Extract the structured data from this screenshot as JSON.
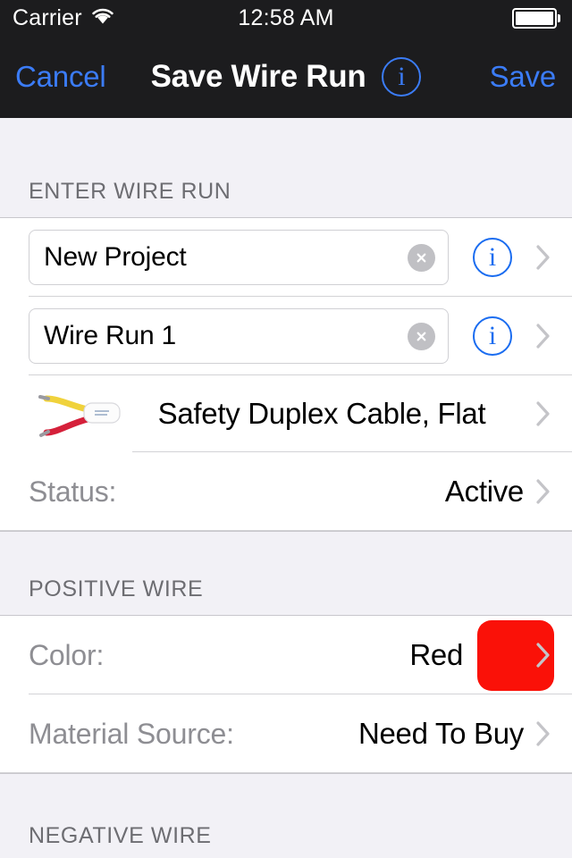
{
  "status_bar": {
    "carrier": "Carrier",
    "wifi_icon": "wifi-icon",
    "time": "12:58 AM",
    "battery_icon": "battery-full-icon"
  },
  "nav_bar": {
    "cancel_label": "Cancel",
    "title": "Save Wire Run",
    "info_icon": "info-circle-icon",
    "info_glyph": "i",
    "save_label": "Save"
  },
  "sections": [
    {
      "header": "ENTER WIRE RUN",
      "rows": [
        {
          "kind": "textfield",
          "name": "project-name",
          "value": "New Project",
          "placeholder": "Project Name",
          "clear_icon": "clear-circle-icon",
          "info_icon": "info-circle-icon",
          "info_glyph": "i",
          "chevron_icon": "chevron-right-icon"
        },
        {
          "kind": "textfield",
          "name": "wire-run-name",
          "value": "Wire Run 1",
          "placeholder": "Wire Run Name",
          "clear_icon": "clear-circle-icon",
          "info_icon": "info-circle-icon",
          "info_glyph": "i",
          "chevron_icon": "chevron-right-icon"
        },
        {
          "kind": "cable",
          "name": "cable-type",
          "image_icon": "duplex-cable-image",
          "value": "Safety Duplex Cable, Flat",
          "chevron_icon": "chevron-right-icon"
        },
        {
          "kind": "labelvalue",
          "name": "status",
          "label": "Status:",
          "value": "Active",
          "chevron_icon": "chevron-right-icon"
        }
      ]
    },
    {
      "header": "POSITIVE WIRE",
      "rows": [
        {
          "kind": "color",
          "name": "positive-wire-color",
          "label": "Color:",
          "value": "Red",
          "swatch_color": "#fa1108",
          "chevron_icon": "chevron-right-icon"
        },
        {
          "kind": "labelvalue",
          "name": "positive-material-source",
          "label": "Material Source:",
          "value": "Need To Buy",
          "chevron_icon": "chevron-right-icon"
        }
      ]
    },
    {
      "header": "NEGATIVE WIRE",
      "rows": []
    }
  ],
  "colors": {
    "accent_blue": "#3b7cf7",
    "nav_background": "#1c1c1e",
    "section_background": "#f2f1f6",
    "row_background": "#ffffff",
    "label_gray": "#8e8e93",
    "red_swatch": "#fa1108"
  }
}
